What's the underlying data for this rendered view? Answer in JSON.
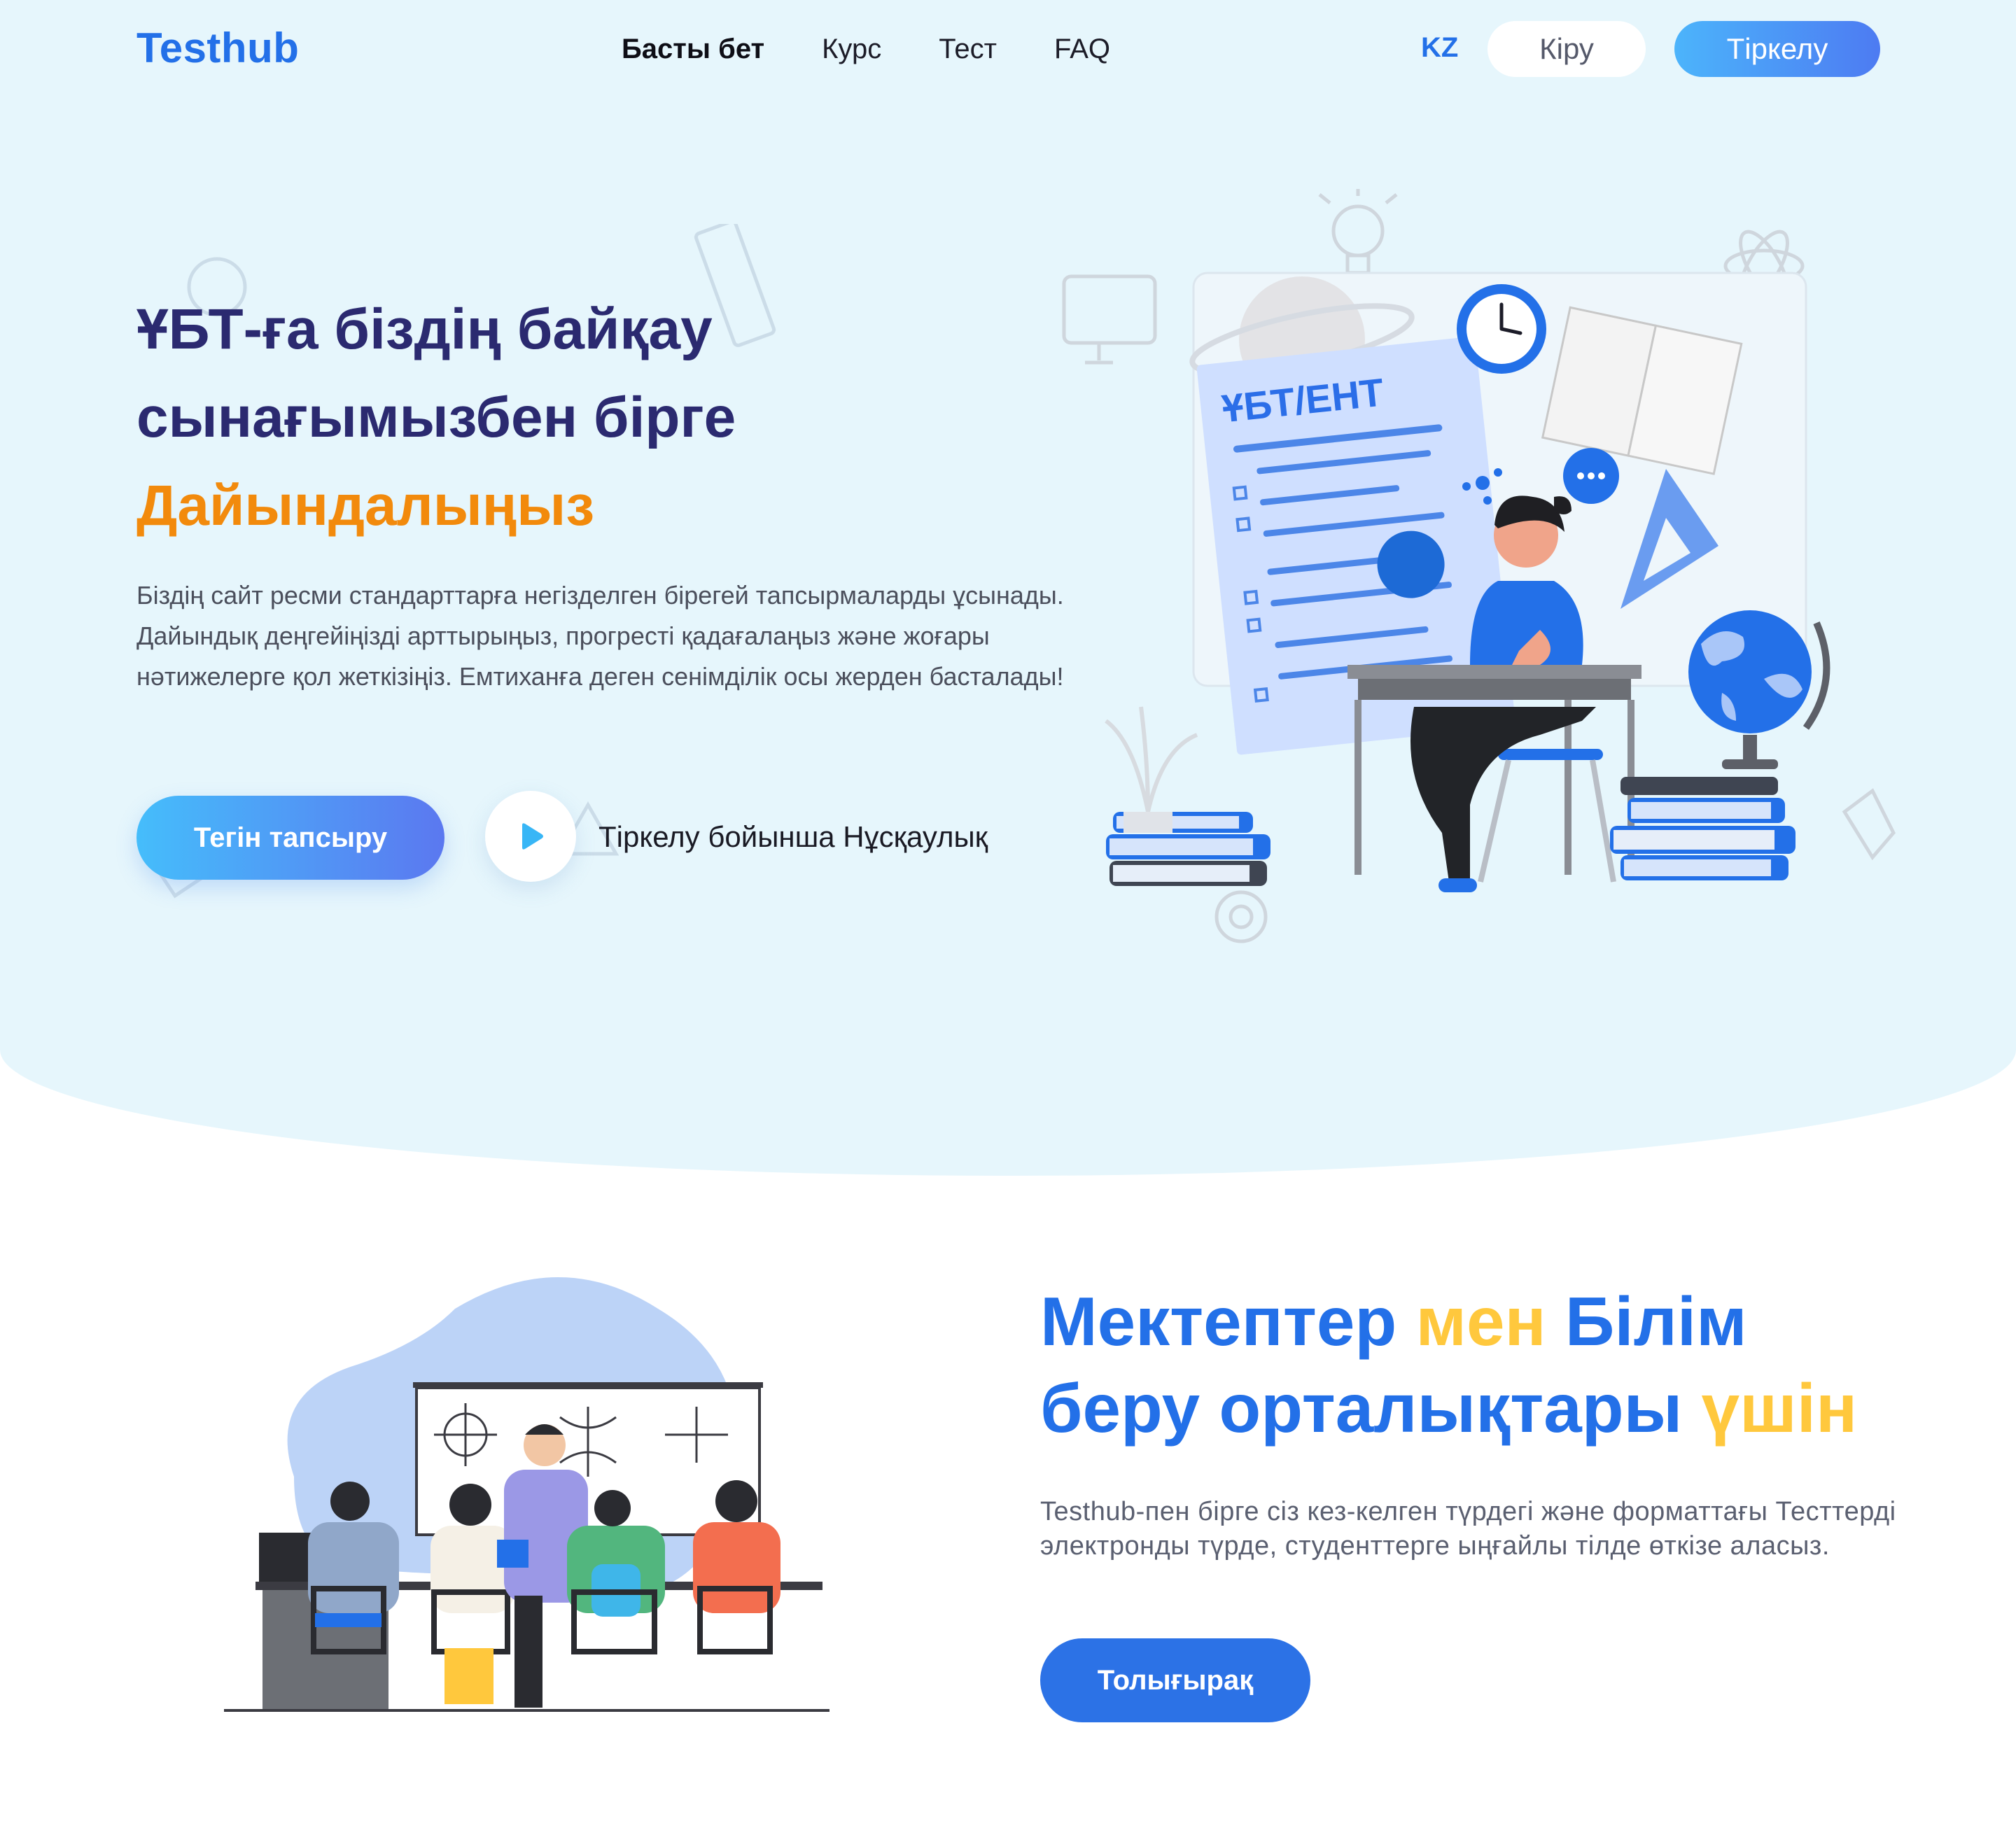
{
  "header": {
    "logo": "Testhub",
    "nav": [
      {
        "label": "Басты бет",
        "active": true
      },
      {
        "label": "Курс",
        "active": false
      },
      {
        "label": "Тест",
        "active": false
      },
      {
        "label": "FAQ",
        "active": false
      }
    ],
    "language": "KZ",
    "login_label": "Кіру",
    "register_label": "Тіркелу"
  },
  "hero": {
    "title_line1": "ҰБТ-ға біздің байқау",
    "title_line2": "сынағымызбен бірге",
    "title_accent": "Дайындалыңыз",
    "description": "Біздің сайт ресми стандарттарға негізделген бірегей тапсырмаларды ұсынады. Дайындық деңгейіңізді арттырыңыз, прогресті қадағалаңыз және жоғары нәтижелерге қол жеткізіңіз. Емтиханға деген сенімділік осы жерден басталады!",
    "cta_label": "Тегін тапсыру",
    "video_label": "Тіркелу бойынша Нұсқаулық",
    "illustration_text": "ҰБТ/ЕНТ"
  },
  "schools": {
    "title_part1": "Мектептер",
    "title_part2": "мен",
    "title_part3": "Білім",
    "title_part4": "беру орталықтары",
    "title_part5": "үшін",
    "description": "Testhub-пен бірге сіз кез-келген түрдегі және форматтағы Тесттерді электронды түрде, студенттерге ыңғайлы тілде өткізе аласыз.",
    "button_label": "Толығырақ"
  },
  "colors": {
    "brand_blue": "#2370e8",
    "title_navy": "#2b2a70",
    "accent_orange": "#f28a0c",
    "accent_yellow": "#ffc83d",
    "hero_bg": "#e6f6fc"
  },
  "icons": [
    "play-icon"
  ]
}
